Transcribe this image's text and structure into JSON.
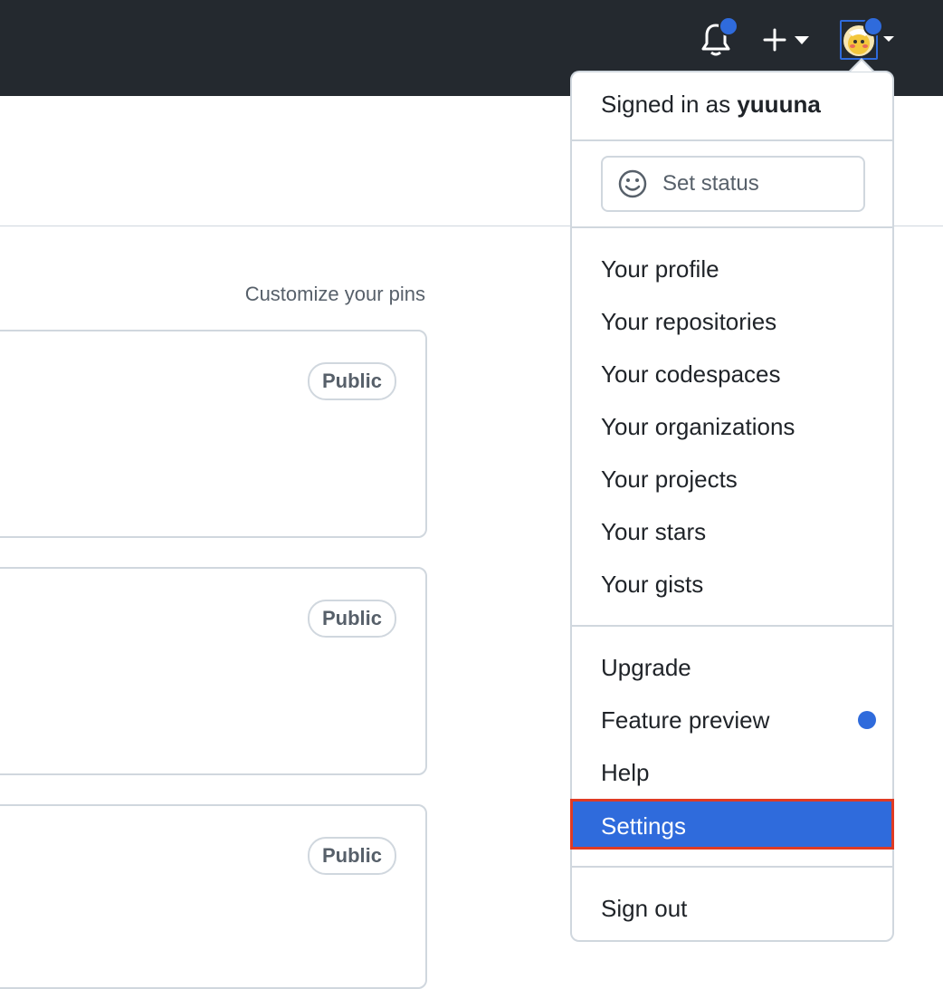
{
  "header": {
    "notifications_icon": "bell-icon",
    "create_icon": "plus-icon",
    "avatar_icon": "avatar-image"
  },
  "main": {
    "customize_pins": "Customize your pins",
    "pins": [
      {
        "badge": "Public"
      },
      {
        "badge": "Public"
      },
      {
        "badge": "Public"
      }
    ]
  },
  "menu": {
    "signed_in_prefix": "Signed in as",
    "username": "yuuuna",
    "set_status": "Set status",
    "items_group1": [
      "Your profile",
      "Your repositories",
      "Your codespaces",
      "Your organizations",
      "Your projects",
      "Your stars",
      "Your gists"
    ],
    "items_group2": [
      "Upgrade",
      "Feature preview",
      "Help",
      "Settings"
    ],
    "sign_out": "Sign out"
  },
  "colors": {
    "header_bg": "#24292f",
    "accent": "#2f6bdc",
    "highlight_border": "#e03b24"
  }
}
